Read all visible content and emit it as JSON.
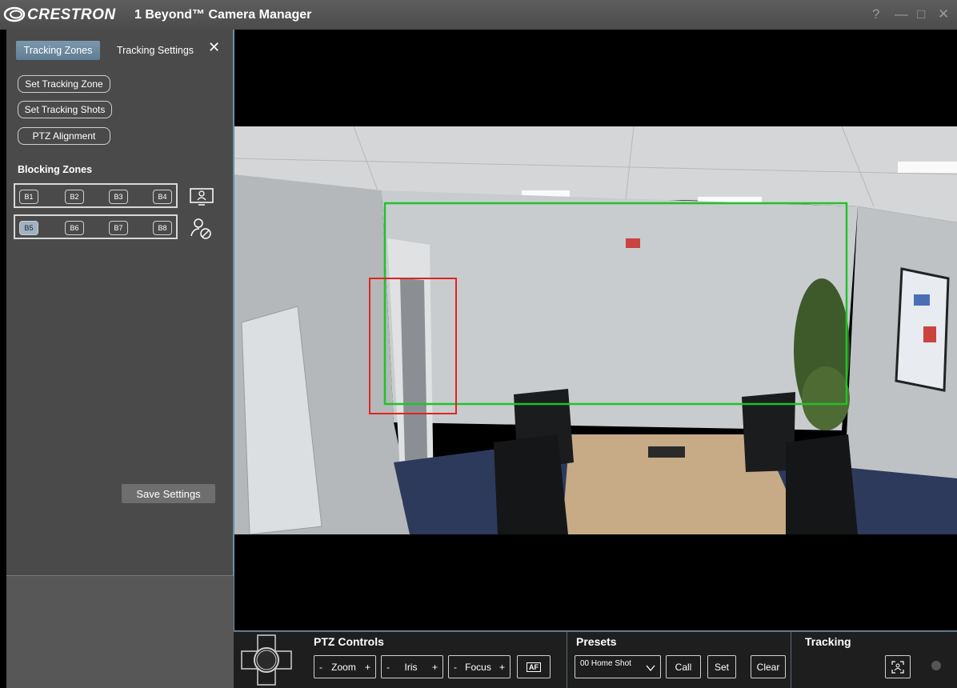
{
  "titlebar": {
    "brand": "CRESTRON",
    "title": "1 Beyond™ Camera Manager",
    "help": "?",
    "minimize": "—",
    "maximize": "□",
    "close": "✕"
  },
  "sidebar": {
    "tabs": [
      {
        "label": "Tracking Zones",
        "active": true
      },
      {
        "label": "Tracking Settings",
        "active": false
      }
    ],
    "close_label": "✕",
    "actions": [
      "Set Tracking Zone",
      "Set Tracking Shots",
      "PTZ Alignment"
    ],
    "blocking_zones_label": "Blocking Zones",
    "zones_row1": [
      "B1",
      "B2",
      "B3",
      "B4"
    ],
    "zones_row2": [
      "B5",
      "B6",
      "B7",
      "B8"
    ],
    "selected_zone": "B5",
    "save_label": "Save Settings"
  },
  "controls": {
    "ptz_title": "PTZ Controls",
    "zoom": {
      "minus": "-",
      "label": "Zoom",
      "plus": "+"
    },
    "iris": {
      "minus": "-",
      "label": "Iris",
      "plus": "+"
    },
    "focus": {
      "minus": "-",
      "label": "Focus",
      "plus": "+"
    },
    "af_label": "AF",
    "presets_title": "Presets",
    "preset_value": "00 Home Shot",
    "call_label": "Call",
    "set_label": "Set",
    "clear_label": "Clear",
    "tracking_title": "Tracking"
  },
  "colors": {
    "accent": "#6b8fa7",
    "tracking_zone": "#22c12a",
    "blocking_zone": "#e0241f"
  }
}
